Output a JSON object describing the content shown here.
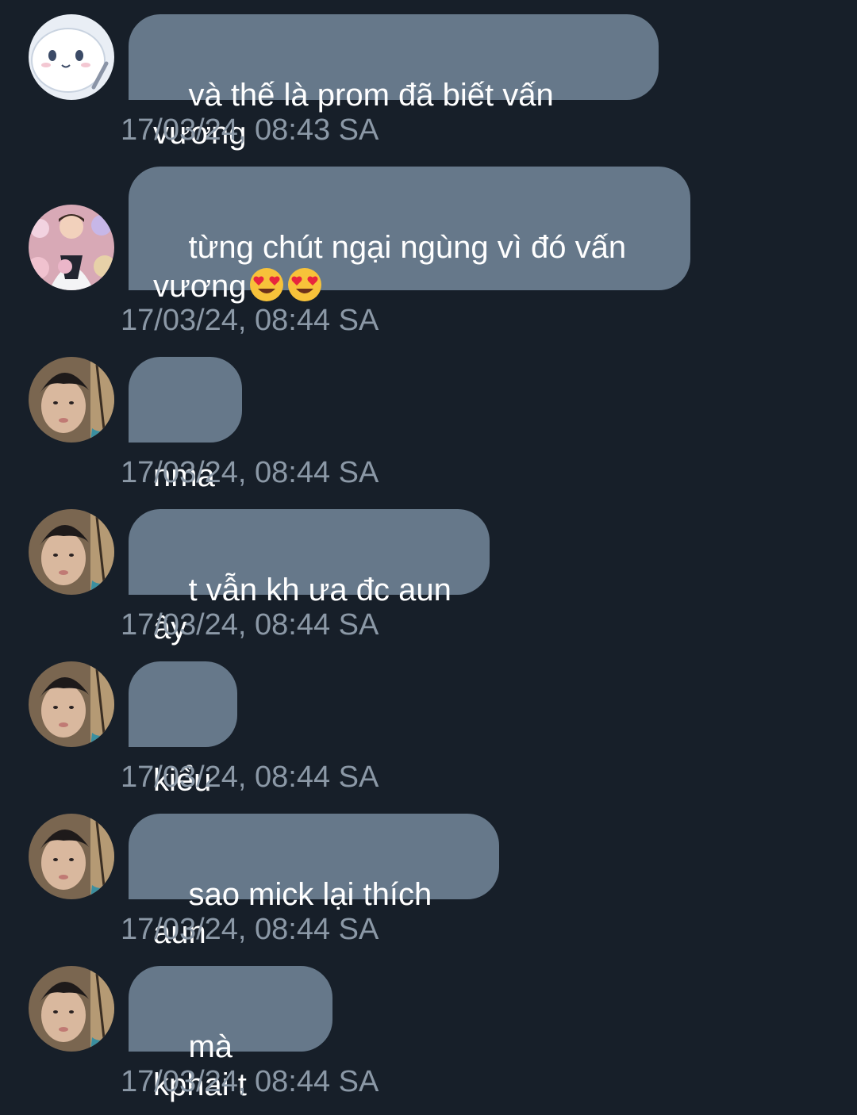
{
  "messages": [
    {
      "avatar": "avatar-cartoon",
      "text": "và thế là prom đã biết vấn vương",
      "time": "17/03/24, 08:43 SA"
    },
    {
      "avatar": "avatar-person-plush",
      "text": "từng chút ngại ngùng vì đó vấn\nvương",
      "emoji": "heart-eyes-emoji",
      "time": "17/03/24, 08:44 SA"
    },
    {
      "avatar": "avatar-person",
      "text": "nma",
      "time": "17/03/24, 08:44 SA"
    },
    {
      "avatar": "avatar-person",
      "text": "t vẫn kh ưa đc aun ấy",
      "time": "17/03/24, 08:44 SA"
    },
    {
      "avatar": "avatar-person",
      "text": "kiểu",
      "time": "17/03/24, 08:44 SA"
    },
    {
      "avatar": "avatar-person",
      "text": "sao mick lại thích aun",
      "time": "17/03/24, 08:44 SA"
    },
    {
      "avatar": "avatar-person",
      "text": "mà kphai t",
      "time": "17/03/24, 08:44 SA"
    }
  ],
  "colors": {
    "background": "#171f29",
    "bubble": "#66788a",
    "timestamp": "#8b98a6"
  }
}
